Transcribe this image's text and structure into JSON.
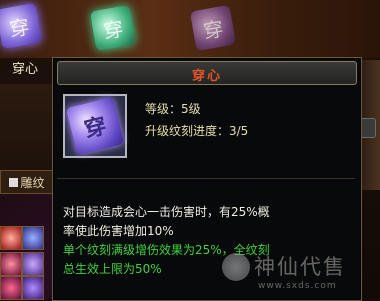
{
  "scene": {
    "left_label": "穿心",
    "slot_glyphs": [
      "穿",
      "穿",
      "穿"
    ],
    "tab_label": "雕纹"
  },
  "tooltip": {
    "title": "穿心",
    "icon_glyph": "穿",
    "level_text": "等级：5级",
    "progress_text": "升级纹刻进度：3/5",
    "description_lines": [
      "对目标造成会心一击伤害时，有25%概",
      "率使此伤害增加10%"
    ],
    "bonus_lines": [
      "单个纹刻满级增伤效果为25%，全纹刻",
      "总生效上限为50%"
    ]
  },
  "watermark": {
    "text": "神仙代售",
    "url": "www.sxds.com"
  },
  "colors": {
    "title": "#e0542a",
    "stat": "#e9dfa8",
    "description": "#f1ede2",
    "bonus": "#3fd23a"
  }
}
